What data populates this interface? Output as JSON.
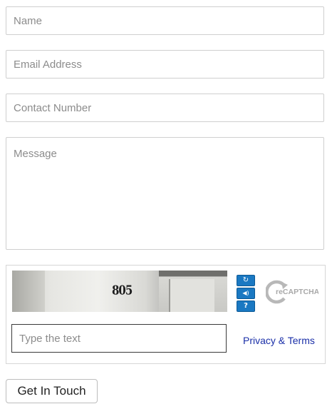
{
  "form": {
    "name_placeholder": "Name",
    "email_placeholder": "Email Address",
    "contact_placeholder": "Contact Number",
    "message_placeholder": "Message"
  },
  "captcha": {
    "image_text": "805",
    "input_placeholder": "Type the text",
    "privacy_label": "Privacy & Terms",
    "logo_text": "reCAPTCHA™",
    "controls": [
      {
        "icon": "refresh-icon",
        "glyph": "↻"
      },
      {
        "icon": "audio-icon",
        "glyph": "◀)"
      },
      {
        "icon": "help-icon",
        "glyph": "?"
      }
    ],
    "control_color": "#1a78c2"
  },
  "submit": {
    "label": "Get In Touch"
  },
  "colors": {
    "link": "#1a2fa8",
    "border": "#cfcfcf",
    "placeholder": "#8c8c8c"
  }
}
